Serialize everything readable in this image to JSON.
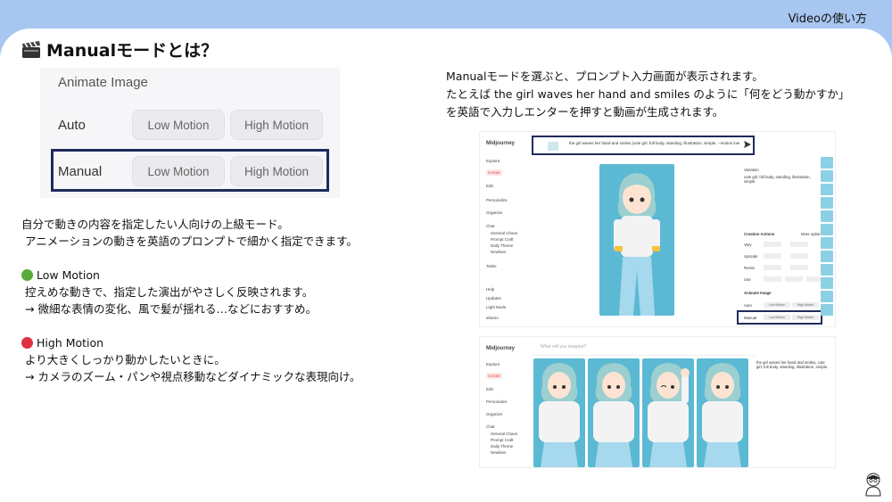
{
  "header": {
    "top_label": "Videoの使い方",
    "title": "Manualモードとは？"
  },
  "animate_panel": {
    "title": "Animate Image",
    "rows": [
      {
        "label": "Auto",
        "buttons": [
          "Low Motion",
          "High Motion"
        ]
      },
      {
        "label": "Manual",
        "buttons": [
          "Low Motion",
          "High Motion"
        ]
      }
    ]
  },
  "left_text": {
    "intro_1": "自分で動きの内容を指定したい人向けの上級モード。",
    "intro_2": "アニメーションの動きを英語のプロンプトで細かく指定できます。",
    "low_title": "Low Motion",
    "low_1": "控えめな動きで、指定した演出がやさしく反映されます。",
    "low_2": "→ 微細な表情の変化、風で髪が揺れる…などにおすすめ。",
    "high_title": "High Motion",
    "high_1": "より大きくしっかり動かしたいときに。",
    "high_2": "→ カメラのズーム・パンや視点移動などダイナミックな表現向け。"
  },
  "right_text": {
    "line_1": "Manualモードを選ぶと、プロンプト入力画面が表示されます。",
    "line_2": "たとえば the girl waves her hand and smiles のように「何をどう動かすか」",
    "line_3": "を英語で入力しエンターを押すと動画が生成されます。"
  },
  "screenshot1": {
    "logo": "Midjourney",
    "sidebar": [
      "Explore",
      "Create",
      "Edit",
      "Personalize",
      "Organize",
      "Chat",
      "General Chaos",
      "Prompt Craft",
      "Daily Theme",
      "Newbies",
      "Tasks",
      "Help",
      "Updates",
      "Light Mode",
      "ahamo"
    ],
    "prompt": "the girl waves her hand and smiles,|cute girl, full body, standing, illustration, simple, --motion low",
    "variation_label": "Variation",
    "desc": "cute girl, full body, standing, illustration, simple.",
    "creation_actions": "Creation Actions",
    "more_options": "More options",
    "vary": "Vary",
    "upscale": "Upscale",
    "remix": "Remix",
    "use": "Use",
    "animate_label": "Animate Image",
    "auto": "Auto",
    "manual": "Manual",
    "low": "Low Motion",
    "high": "High Motion"
  },
  "screenshot2": {
    "logo": "Midjourney",
    "sidebar": [
      "Explore",
      "Create",
      "Edit",
      "Personalize",
      "Organize",
      "Chat",
      "General Chaos",
      "Prompt Craft",
      "Daily Theme",
      "Newbies"
    ],
    "search_placeholder": "What will you imagine?",
    "desc": "the girl waves her hand and smiles, cute girl, full body, standing, illustration, simple."
  },
  "colors": {
    "low": "#5aaa3c",
    "high": "#e03040",
    "accent_frame": "#1f2c5a"
  }
}
